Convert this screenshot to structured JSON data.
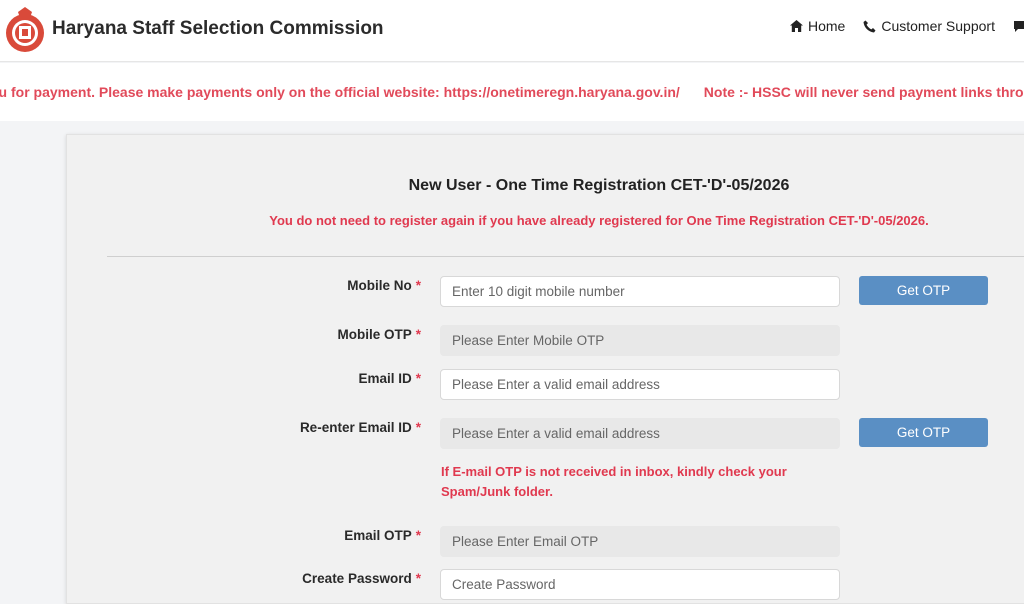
{
  "header": {
    "title": "Haryana Staff Selection Commission",
    "nav": [
      {
        "label": "Home",
        "icon": "home-icon"
      },
      {
        "label": "Customer Support",
        "icon": "phone-icon"
      },
      {
        "label": "",
        "icon": "chat-icon"
      }
    ]
  },
  "ticker": {
    "text": "ou for payment. Please make payments only on the official website: https://onetimeregn.haryana.gov.in/",
    "note_label": "Note :-",
    "note_text": " HSSC will never send payment links through"
  },
  "form": {
    "title": "New User - One Time Registration CET-'D'-05/2026",
    "subtitle": "You do not need to register again if you have already registered for One Time Registration CET-'D'-05/2026.",
    "required_mark": "*",
    "fields": {
      "mobile_no": {
        "label": "Mobile No",
        "placeholder": "Enter 10 digit mobile number"
      },
      "mobile_otp": {
        "label": "Mobile OTP",
        "placeholder": "Please Enter Mobile OTP"
      },
      "email_id": {
        "label": "Email ID",
        "placeholder": "Please Enter a valid email address"
      },
      "reenter_email": {
        "label": "Re-enter Email ID",
        "placeholder": "Please Enter a valid email address"
      },
      "email_otp": {
        "label": "Email OTP",
        "placeholder": "Please Enter Email OTP"
      },
      "create_password": {
        "label": "Create Password",
        "placeholder": "Create Password"
      }
    },
    "get_otp_label": "Get OTP",
    "email_warning": "If E-mail OTP is not received in inbox, kindly check your Spam/Junk folder."
  },
  "colors": {
    "accent": "#5a8fc4",
    "alert": "#e0394f"
  }
}
